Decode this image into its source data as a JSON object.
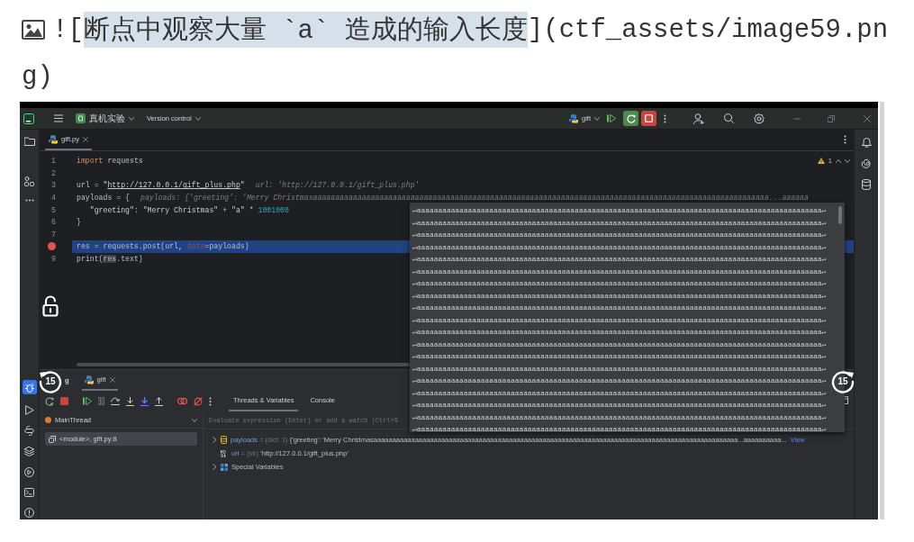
{
  "doc": {
    "line_1": {
      "prefix": "![",
      "alt": "断点中观察大量 `a` 造成的输入长度",
      "alt_selected": true,
      "suffix": "](ctf_assets/image59.pn"
    },
    "line_2": "g)"
  },
  "ide": {
    "title_bar": {
      "project": "真机实验",
      "vcs": "Version control",
      "run_config": "gift"
    },
    "editor_tabs": [
      {
        "label": "gift.py",
        "selected": true
      }
    ],
    "inspections": {
      "warnings": "1"
    },
    "code_lines": [
      {
        "number": "1",
        "breakpoint": false,
        "highlighted": false,
        "tokens": [
          {
            "text": "import",
            "kind": "keyword"
          },
          {
            "text": " requests",
            "kind": "plain"
          }
        ]
      },
      {
        "number": "2",
        "breakpoint": false,
        "highlighted": false
      },
      {
        "number": "3",
        "breakpoint": false,
        "highlighted": false,
        "tokens": [
          {
            "text": "url = ",
            "kind": "plain"
          },
          {
            "text": "\"",
            "kind": "string"
          },
          {
            "text": "http://127.0.0.1/gift_plus.php",
            "kind": "url"
          },
          {
            "text": "\"",
            "kind": "string"
          }
        ],
        "hint": "url: 'http://127.0.0.1/gift_plus.php'"
      },
      {
        "number": "4",
        "breakpoint": false,
        "highlighted": false,
        "tokens": [
          {
            "text": "payloads = {",
            "kind": "plain"
          }
        ],
        "hint": "payloads: {'greeting': 'Merry Christmasaaaaaaaaaaaaaaaaaaaaaaaaaaaaaaaaaaaaaaaaaaaaaaaaaaaaaaaaaaaaaaaaaaaaaaaaaaaaaaaaaaaaaaaaaaaaaaaaaaaaaaa...aaaaaa"
      },
      {
        "number": "5",
        "breakpoint": false,
        "highlighted": false,
        "tokens": [
          {
            "text": "   \"greeting\"",
            "kind": "string"
          },
          {
            "text": ": ",
            "kind": "plain"
          },
          {
            "text": "\"Merry Christmas\"",
            "kind": "string"
          },
          {
            "text": " + ",
            "kind": "plain"
          },
          {
            "text": "\"a\"",
            "kind": "string"
          },
          {
            "text": " * ",
            "kind": "plain"
          },
          {
            "text": "1001000",
            "kind": "number"
          }
        ]
      },
      {
        "number": "6",
        "breakpoint": false,
        "highlighted": false,
        "tokens": [
          {
            "text": "}",
            "kind": "plain"
          }
        ]
      },
      {
        "number": "7",
        "breakpoint": false,
        "highlighted": false
      },
      {
        "breakpoint": true,
        "highlighted": true,
        "tokens": [
          {
            "text": "res = requests.post(url, ",
            "kind": "plain"
          },
          {
            "text": "data",
            "kind": "param"
          },
          {
            "text": "=payloads)",
            "kind": "plain"
          }
        ]
      },
      {
        "number": "9",
        "breakpoint": false,
        "highlighted": false,
        "tokens": [
          {
            "text": "print(",
            "kind": "plain"
          },
          {
            "text": "res",
            "kind": "ref"
          },
          {
            "text": ".text)",
            "kind": "plain"
          }
        ]
      }
    ],
    "popup_lines": [
      "↵aaaaaaaaaaaaaaaaaaaaaaaaaaaaaaaaaaaaaaaaaaaaaaaaaaaaaaaaaaaaaaaaaaaaaaaaaaaaaaaaaaaaaaaaaaaaaaa↵",
      "↵aaaaaaaaaaaaaaaaaaaaaaaaaaaaaaaaaaaaaaaaaaaaaaaaaaaaaaaaaaaaaaaaaaaaaaaaaaaaaaaaaaaaaaaaaaaaaaa↵",
      "↵aaaaaaaaaaaaaaaaaaaaaaaaaaaaaaaaaaaaaaaaaaaaaaaaaaaaaaaaaaaaaaaaaaaaaaaaaaaaaaaaaaaaaaaaaaaaaaa↵",
      "↵aaaaaaaaaaaaaaaaaaaaaaaaaaaaaaaaaaaaaaaaaaaaaaaaaaaaaaaaaaaaaaaaaaaaaaaaaaaaaaaaaaaaaaaaaaaaaaa↵",
      "↵aaaaaaaaaaaaaaaaaaaaaaaaaaaaaaaaaaaaaaaaaaaaaaaaaaaaaaaaaaaaaaaaaaaaaaaaaaaaaaaaaaaaaaaaaaaaaaa↵",
      "↵aaaaaaaaaaaaaaaaaaaaaaaaaaaaaaaaaaaaaaaaaaaaaaaaaaaaaaaaaaaaaaaaaaaaaaaaaaaaaaaaaaaaaaaaaaaaaaa↵",
      "↵aaaaaaaaaaaaaaaaaaaaaaaaaaaaaaaaaaaaaaaaaaaaaaaaaaaaaaaaaaaaaaaaaaaaaaaaaaaaaaaaaaaaaaaaaaaaaaa↵",
      "↵aaaaaaaaaaaaaaaaaaaaaaaaaaaaaaaaaaaaaaaaaaaaaaaaaaaaaaaaaaaaaaaaaaaaaaaaaaaaaaaaaaaaaaaaaaaaaaa↵",
      "↵aaaaaaaaaaaaaaaaaaaaaaaaaaaaaaaaaaaaaaaaaaaaaaaaaaaaaaaaaaaaaaaaaaaaaaaaaaaaaaaaaaaaaaaaaaaaaaa↵",
      "↵aaaaaaaaaaaaaaaaaaaaaaaaaaaaaaaaaaaaaaaaaaaaaaaaaaaaaaaaaaaaaaaaaaaaaaaaaaaaaaaaaaaaaaaaaaaaaaa↵",
      "↵aaaaaaaaaaaaaaaaaaaaaaaaaaaaaaaaaaaaaaaaaaaaaaaaaaaaaaaaaaaaaaaaaaaaaaaaaaaaaaaaaaaaaaaaaaaaaaa↵",
      "↵aaaaaaaaaaaaaaaaaaaaaaaaaaaaaaaaaaaaaaaaaaaaaaaaaaaaaaaaaaaaaaaaaaaaaaaaaaaaaaaaaaaaaaaaaaaaaaa↵",
      "↵aaaaaaaaaaaaaaaaaaaaaaaaaaaaaaaaaaaaaaaaaaaaaaaaaaaaaaaaaaaaaaaaaaaaaaaaaaaaaaaaaaaaaaaaaaaaaaa↵",
      "↵aaaaaaaaaaaaaaaaaaaaaaaaaaaaaaaaaaaaaaaaaaaaaaaaaaaaaaaaaaaaaaaaaaaaaaaaaaaaaaaaaaaaaaaaaaaaaaa↵",
      "↵aaaaaaaaaaaaaaaaaaaaaaaaaaaaaaaaaaaaaaaaaaaaaaaaaaaaaaaaaaaaaaaaaaaaaaaaaaaaaaaaaaaaaaaaaaaaaaa↵",
      "↵aaaaaaaaaaaaaaaaaaaaaaaaaaaaaaaaaaaaaaaaaaaaaaaaaaaaaaaaaaaaaaaaaaaaaaaaaaaaaaaaaaaaaaaaaaaaaaa↵",
      "↵aaaaaaaaaaaaaaaaaaaaaaaaaaaaaaaaaaaaaaaaaaaaaaaaaaaaaaaaaaaaaaaaaaaaaaaaaaaaaaaaaaaaaaaaaaaaaaa↵",
      "↵aaaaaaaaaaaaaaaaaaaaaaaaaaaaaaaaaaaaaaaaaaaaaaaaaaaaaaaaaaaaaaaaaaaaaaaaaaaaaaaaaaaaaaaaaaaaaaa↵",
      "↵aaaaaaaaaaaaaaaaaaaaaaaaaaaaaaaaaaaaaaaaaaaaaaaaaaaaaaaaaaaaaaaaaaaaaaaaaaaaaaaaaaaaaaaaaaaaaaa↵"
    ],
    "debug": {
      "title": "g",
      "tabs": [
        {
          "label": "gift",
          "selected": true
        }
      ],
      "subtabs": [
        {
          "label": "Threads & Variables",
          "selected": true
        },
        {
          "label": "Console",
          "selected": false
        }
      ],
      "thread": "MainThread",
      "frames": [
        {
          "label": "<module>, gift.py:8",
          "selected": true
        }
      ],
      "evaluate_placeholder": "Evaluate expression (Enter) or add a watch (Ctrl+S",
      "variables": [
        {
          "kind": "dict",
          "expandable": true,
          "name": "payloads",
          "operator": "=",
          "type": "{dict: 1}",
          "value": "{'greeting': 'Merry Christmasaaaaaaaaaaaaaaaaaaaaaaaaaaaaaaaaaaaaaaaaaaaaaaaaaaaaaaaaaaaaaaaaaaaaaaaaaaaaaaaaaaaaaaaaaaaaaaaaa...aaaaaaaaaa...",
          "link": "View"
        },
        {
          "kind": "str",
          "expandable": false,
          "name": "url",
          "operator": "=",
          "type": "{str}",
          "value": "'http://127.0.0.1/gift_plus.php'"
        },
        {
          "kind": "group",
          "expandable": true,
          "name": "Special Variables"
        }
      ]
    },
    "video_overlay": {
      "rewind": "15",
      "forward": "15"
    }
  }
}
